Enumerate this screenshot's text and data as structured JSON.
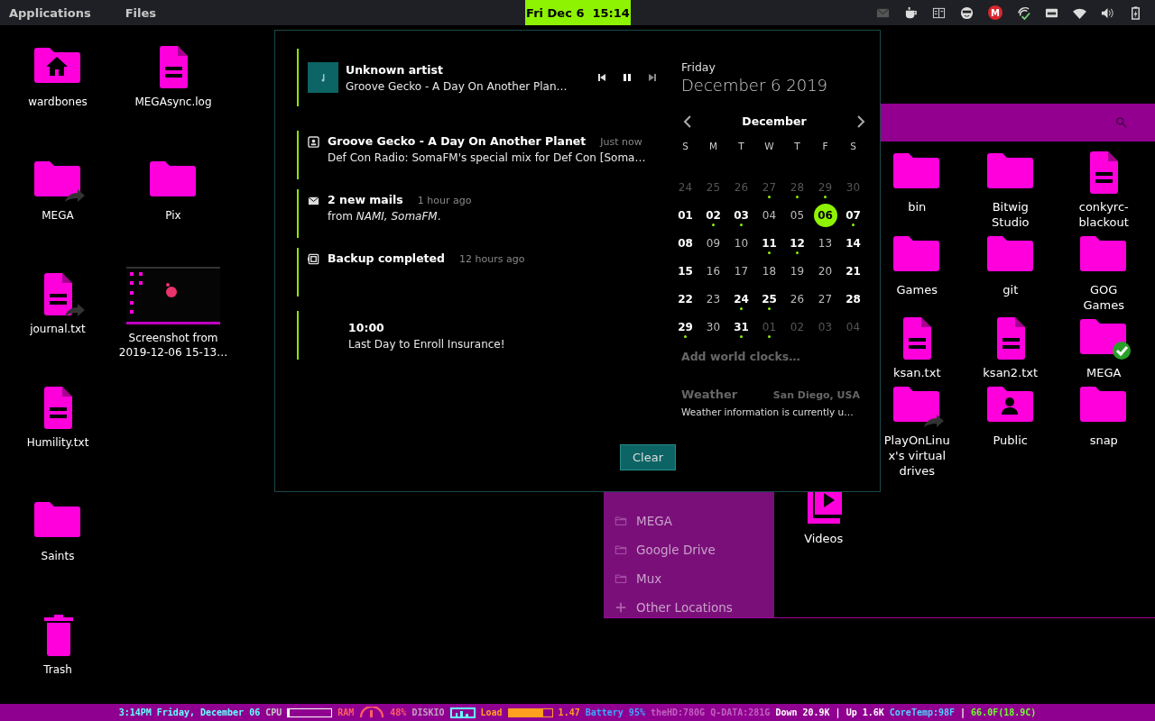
{
  "top_bar": {
    "menus": [
      "Applications",
      "Files"
    ],
    "clock": "Fri Dec 6  15:14",
    "tray": [
      {
        "kind": "mail"
      },
      {
        "kind": "cup"
      },
      {
        "kind": "panel"
      },
      {
        "kind": "face"
      },
      {
        "kind": "mega",
        "label": "M"
      },
      {
        "kind": "sync"
      },
      {
        "kind": "drive"
      },
      {
        "kind": "wifi"
      },
      {
        "kind": "volume"
      },
      {
        "kind": "battery"
      }
    ]
  },
  "desktop": {
    "icons": [
      {
        "label": "wardbones",
        "kind": "home",
        "link": false
      },
      {
        "label": "MEGA",
        "kind": "folder",
        "link": true
      },
      {
        "label": "journal.txt",
        "kind": "file",
        "link": true
      },
      {
        "label": "Humility.txt",
        "kind": "file",
        "link": false
      },
      {
        "label": "Saints",
        "kind": "folder",
        "link": false
      },
      {
        "label": "Trash",
        "kind": "trash",
        "link": false
      },
      {
        "label": "MEGAsync.log",
        "kind": "file",
        "link": false
      },
      {
        "label": "Pix",
        "kind": "folder",
        "link": false
      },
      {
        "label": "Screenshot from 2019-12-06 15-13…",
        "kind": "picture",
        "link": false
      }
    ]
  },
  "file_manager": {
    "sidebar": {
      "items": [
        "MEGA",
        "Google Drive",
        "Mux",
        "Other Locations"
      ]
    },
    "items": [
      {
        "label": "bin",
        "kind": "folder",
        "link": false,
        "synced": false
      },
      {
        "label": "Bitwig Studio",
        "kind": "folder",
        "link": false,
        "synced": false
      },
      {
        "label": "conkyrc-blackout",
        "kind": "file",
        "link": false,
        "synced": false
      },
      {
        "label": "Games",
        "kind": "folder",
        "link": false,
        "synced": false
      },
      {
        "label": "git",
        "kind": "folder",
        "link": false,
        "synced": false
      },
      {
        "label": "GOG Games",
        "kind": "folder",
        "link": false,
        "synced": false
      },
      {
        "label": "ksan.txt",
        "kind": "file",
        "link": false,
        "synced": false
      },
      {
        "label": "ksan2.txt",
        "kind": "file",
        "link": false,
        "synced": false
      },
      {
        "label": "MEGA",
        "kind": "folder",
        "link": false,
        "synced": true
      },
      {
        "label": "PlayOnLinux's virtual drives",
        "kind": "folder",
        "link": true,
        "synced": false
      },
      {
        "label": "Public",
        "kind": "person",
        "link": false,
        "synced": false
      },
      {
        "label": "snap",
        "kind": "folder",
        "link": false,
        "synced": false
      },
      {
        "label": "Videos",
        "kind": "video",
        "link": false,
        "synced": false
      }
    ]
  },
  "notifications": [
    {
      "kind": "media",
      "title": "Unknown artist",
      "body": "Groove Gecko - A Day On Another Plan…"
    },
    {
      "kind": "radio",
      "title": "Groove Gecko - A Day On Another Planet",
      "time": "Just now",
      "body": "Def Con Radio: SomaFM's special mix for Def Con [Soma…"
    },
    {
      "kind": "mail",
      "title": "2 new mails",
      "time": "1 hour ago",
      "body": "from *NAMI, SomaFM*."
    },
    {
      "kind": "backup",
      "title": "Backup completed",
      "time": "12 hours ago"
    },
    {
      "kind": "event",
      "title": "10:00",
      "body": "Last Day to Enroll Insurance!"
    }
  ],
  "clear_button": "Clear",
  "date": {
    "weekday": "Friday",
    "full": "December 6 2019"
  },
  "calendar": {
    "month": "December",
    "weekdays": [
      "S",
      "M",
      "T",
      "W",
      "T",
      "F",
      "S"
    ],
    "days": [
      {
        "day": "24",
        "outside": true,
        "bold": false,
        "event": false,
        "selected": false
      },
      {
        "day": "25",
        "outside": true,
        "bold": false,
        "event": false,
        "selected": false
      },
      {
        "day": "26",
        "outside": true,
        "bold": false,
        "event": false,
        "selected": false
      },
      {
        "day": "27",
        "outside": true,
        "bold": false,
        "event": true,
        "selected": false
      },
      {
        "day": "28",
        "outside": true,
        "bold": false,
        "event": true,
        "selected": false
      },
      {
        "day": "29",
        "outside": true,
        "bold": false,
        "event": true,
        "selected": false
      },
      {
        "day": "30",
        "outside": true,
        "bold": false,
        "event": false,
        "selected": false
      },
      {
        "day": "01",
        "outside": false,
        "bold": true,
        "event": false,
        "selected": false
      },
      {
        "day": "02",
        "outside": false,
        "bold": true,
        "event": true,
        "selected": false
      },
      {
        "day": "03",
        "outside": false,
        "bold": true,
        "event": true,
        "selected": false
      },
      {
        "day": "04",
        "outside": false,
        "bold": false,
        "event": false,
        "selected": false
      },
      {
        "day": "05",
        "outside": false,
        "bold": false,
        "event": false,
        "selected": false
      },
      {
        "day": "06",
        "outside": false,
        "bold": false,
        "event": false,
        "selected": true
      },
      {
        "day": "07",
        "outside": false,
        "bold": true,
        "event": true,
        "selected": false
      },
      {
        "day": "08",
        "outside": false,
        "bold": true,
        "event": false,
        "selected": false
      },
      {
        "day": "09",
        "outside": false,
        "bold": false,
        "event": false,
        "selected": false
      },
      {
        "day": "10",
        "outside": false,
        "bold": false,
        "event": false,
        "selected": false
      },
      {
        "day": "11",
        "outside": false,
        "bold": true,
        "event": true,
        "selected": false
      },
      {
        "day": "12",
        "outside": false,
        "bold": true,
        "event": true,
        "selected": false
      },
      {
        "day": "13",
        "outside": false,
        "bold": false,
        "event": false,
        "selected": false
      },
      {
        "day": "14",
        "outside": false,
        "bold": true,
        "event": false,
        "selected": false
      },
      {
        "day": "15",
        "outside": false,
        "bold": true,
        "event": false,
        "selected": false
      },
      {
        "day": "16",
        "outside": false,
        "bold": false,
        "event": false,
        "selected": false
      },
      {
        "day": "17",
        "outside": false,
        "bold": false,
        "event": false,
        "selected": false
      },
      {
        "day": "18",
        "outside": false,
        "bold": false,
        "event": false,
        "selected": false
      },
      {
        "day": "19",
        "outside": false,
        "bold": false,
        "event": false,
        "selected": false
      },
      {
        "day": "20",
        "outside": false,
        "bold": false,
        "event": false,
        "selected": false
      },
      {
        "day": "21",
        "outside": false,
        "bold": true,
        "event": false,
        "selected": false
      },
      {
        "day": "22",
        "outside": false,
        "bold": true,
        "event": false,
        "selected": false
      },
      {
        "day": "23",
        "outside": false,
        "bold": false,
        "event": false,
        "selected": false
      },
      {
        "day": "24",
        "outside": false,
        "bold": true,
        "event": true,
        "selected": false
      },
      {
        "day": "25",
        "outside": false,
        "bold": true,
        "event": true,
        "selected": false
      },
      {
        "day": "26",
        "outside": false,
        "bold": false,
        "event": false,
        "selected": false
      },
      {
        "day": "27",
        "outside": false,
        "bold": false,
        "event": false,
        "selected": false
      },
      {
        "day": "28",
        "outside": false,
        "bold": true,
        "event": false,
        "selected": false
      },
      {
        "day": "29",
        "outside": false,
        "bold": true,
        "event": true,
        "selected": false
      },
      {
        "day": "30",
        "outside": false,
        "bold": false,
        "event": false,
        "selected": false
      },
      {
        "day": "31",
        "outside": false,
        "bold": true,
        "event": true,
        "selected": false
      },
      {
        "day": "01",
        "outside": true,
        "bold": false,
        "event": true,
        "selected": false
      },
      {
        "day": "02",
        "outside": true,
        "bold": false,
        "event": false,
        "selected": false
      },
      {
        "day": "03",
        "outside": true,
        "bold": false,
        "event": false,
        "selected": false
      },
      {
        "day": "04",
        "outside": true,
        "bold": false,
        "event": false,
        "selected": false
      }
    ]
  },
  "world_clocks": "Add world clocks…",
  "weather": {
    "title": "Weather",
    "location": "San Diego, USA",
    "text": "Weather information is currently u…"
  },
  "status_bar": {
    "segments": [
      {
        "kind": "text",
        "text": "3:14PM Friday, December 06",
        "color": "#66ffff"
      },
      {
        "kind": "text",
        "text": "CPU",
        "color": "#c8c8c8"
      },
      {
        "kind": "bar",
        "level": 0.03,
        "color": "#ffffff"
      },
      {
        "kind": "text",
        "text": "RAM",
        "color": "#ff5f5f"
      },
      {
        "kind": "gauge",
        "color": "#ff5f5f"
      },
      {
        "kind": "text",
        "text": "48%",
        "color": "#ff5f5f"
      },
      {
        "kind": "text",
        "text": "DISKIO",
        "color": "#c0a0c0"
      },
      {
        "kind": "graph",
        "color": "#66ffff"
      },
      {
        "kind": "text",
        "text": "Load",
        "color": "#ffa020"
      },
      {
        "kind": "bar",
        "level": 0.8,
        "color": "#ffa020"
      },
      {
        "kind": "text",
        "text": "1.47",
        "color": "#ffa020"
      },
      {
        "kind": "text",
        "text": "Battery 95%",
        "color": "#3ea6ff"
      },
      {
        "kind": "text",
        "text": "theHD:780G Q-DATA:281G",
        "color": "#c060c0"
      },
      {
        "kind": "text",
        "text": "Down 20.9K | Up 1.6K",
        "color": "#ffffff"
      },
      {
        "kind": "text",
        "text": "CoreTemp:98F",
        "color": "#50d0ff"
      },
      {
        "kind": "text",
        "text": "|"
      },
      {
        "kind": "text",
        "text": "66.0F(18.9C)",
        "color": "#70ff30"
      }
    ]
  }
}
